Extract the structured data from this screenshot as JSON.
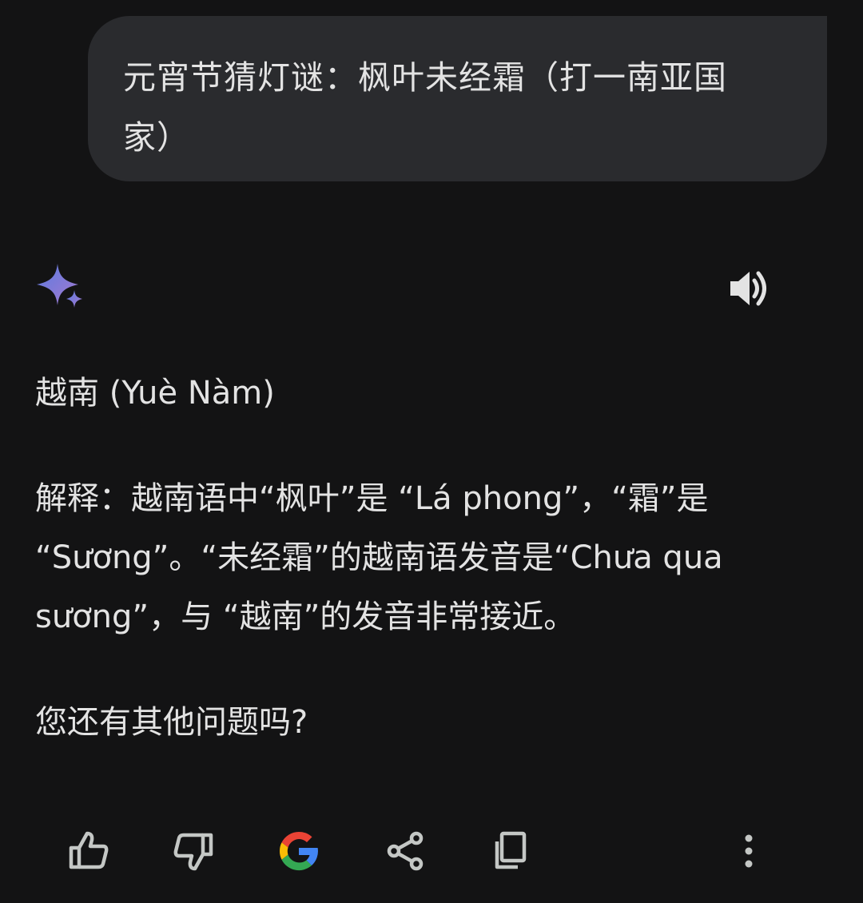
{
  "user_message": {
    "text": "元宵节猜灯谜：枫叶未经霜（打一南亚国家）"
  },
  "assistant": {
    "logo_icon": "gemini-sparkle-icon",
    "listen_icon": "speaker-icon",
    "answer_title": "越南 (Yuè Nàm)",
    "explanation": "解释：越南语中“枫叶”是 “Lá phong”，“霜”是 “Sương”。“未经霜”的越南语发音是“Chưa qua sương”，与 “越南”的发音非常接近。",
    "follow_up": "您还有其他问题吗?"
  },
  "toolbar": {
    "icons": [
      "thumbs-up-icon",
      "thumbs-down-icon",
      "google-icon",
      "share-icon",
      "copy-icon",
      "more-vert-icon"
    ]
  },
  "colors": {
    "background": "#131314",
    "bubble": "#2a2b2e",
    "text": "#e3e3e3",
    "icon": "#c4c7c5",
    "spark_blue": "#6f86d6",
    "spark_purple": "#9b72cb"
  }
}
